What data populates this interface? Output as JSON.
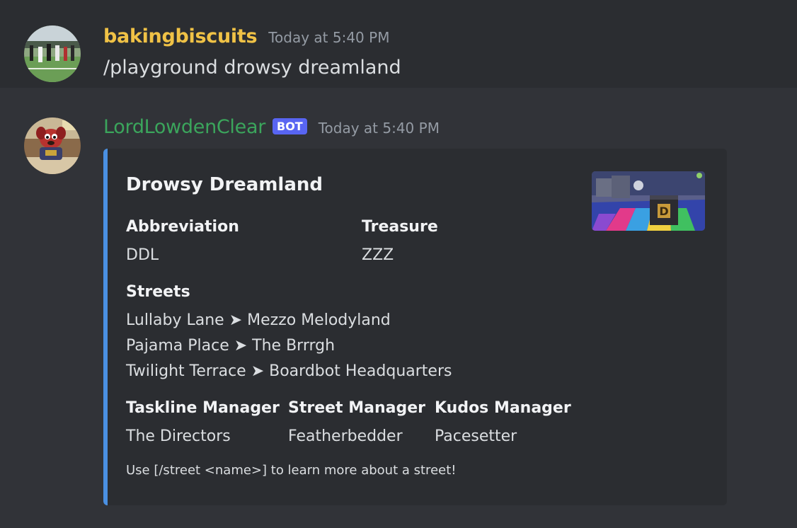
{
  "messages": [
    {
      "username": "bakingbiscuits",
      "timestamp": "Today at 5:40 PM",
      "content": "/playground drowsy dreamland"
    },
    {
      "username": "LordLowdenClear",
      "badge": "BOT",
      "timestamp": "Today at 5:40 PM",
      "embed": {
        "accent_color": "#4a90e2",
        "title": "Drowsy Dreamland",
        "fields": {
          "abbreviation": {
            "name": "Abbreviation",
            "value": "DDL"
          },
          "treasure": {
            "name": "Treasure",
            "value": "ZZZ"
          },
          "streets": {
            "name": "Streets",
            "lines": [
              "Lullaby Lane ➤ Mezzo Melodyland",
              "Pajama Place ➤ The Brrrgh",
              "Twilight Terrace ➤ Boardbot Headquarters"
            ]
          },
          "taskline_manager": {
            "name": "Taskline Manager",
            "value": "The Directors"
          },
          "street_manager": {
            "name": "Street Manager",
            "value": "Featherbedder"
          },
          "kudos_manager": {
            "name": "Kudos Manager",
            "value": "Pacesetter"
          }
        },
        "footer": "Use [/street <name>] to learn more about a street!"
      }
    }
  ],
  "colors": {
    "background": "#313338",
    "username_1": "#f0c246",
    "username_2": "#3ba55c",
    "bot_badge": "#5865f2",
    "timestamp": "#949ba4"
  }
}
